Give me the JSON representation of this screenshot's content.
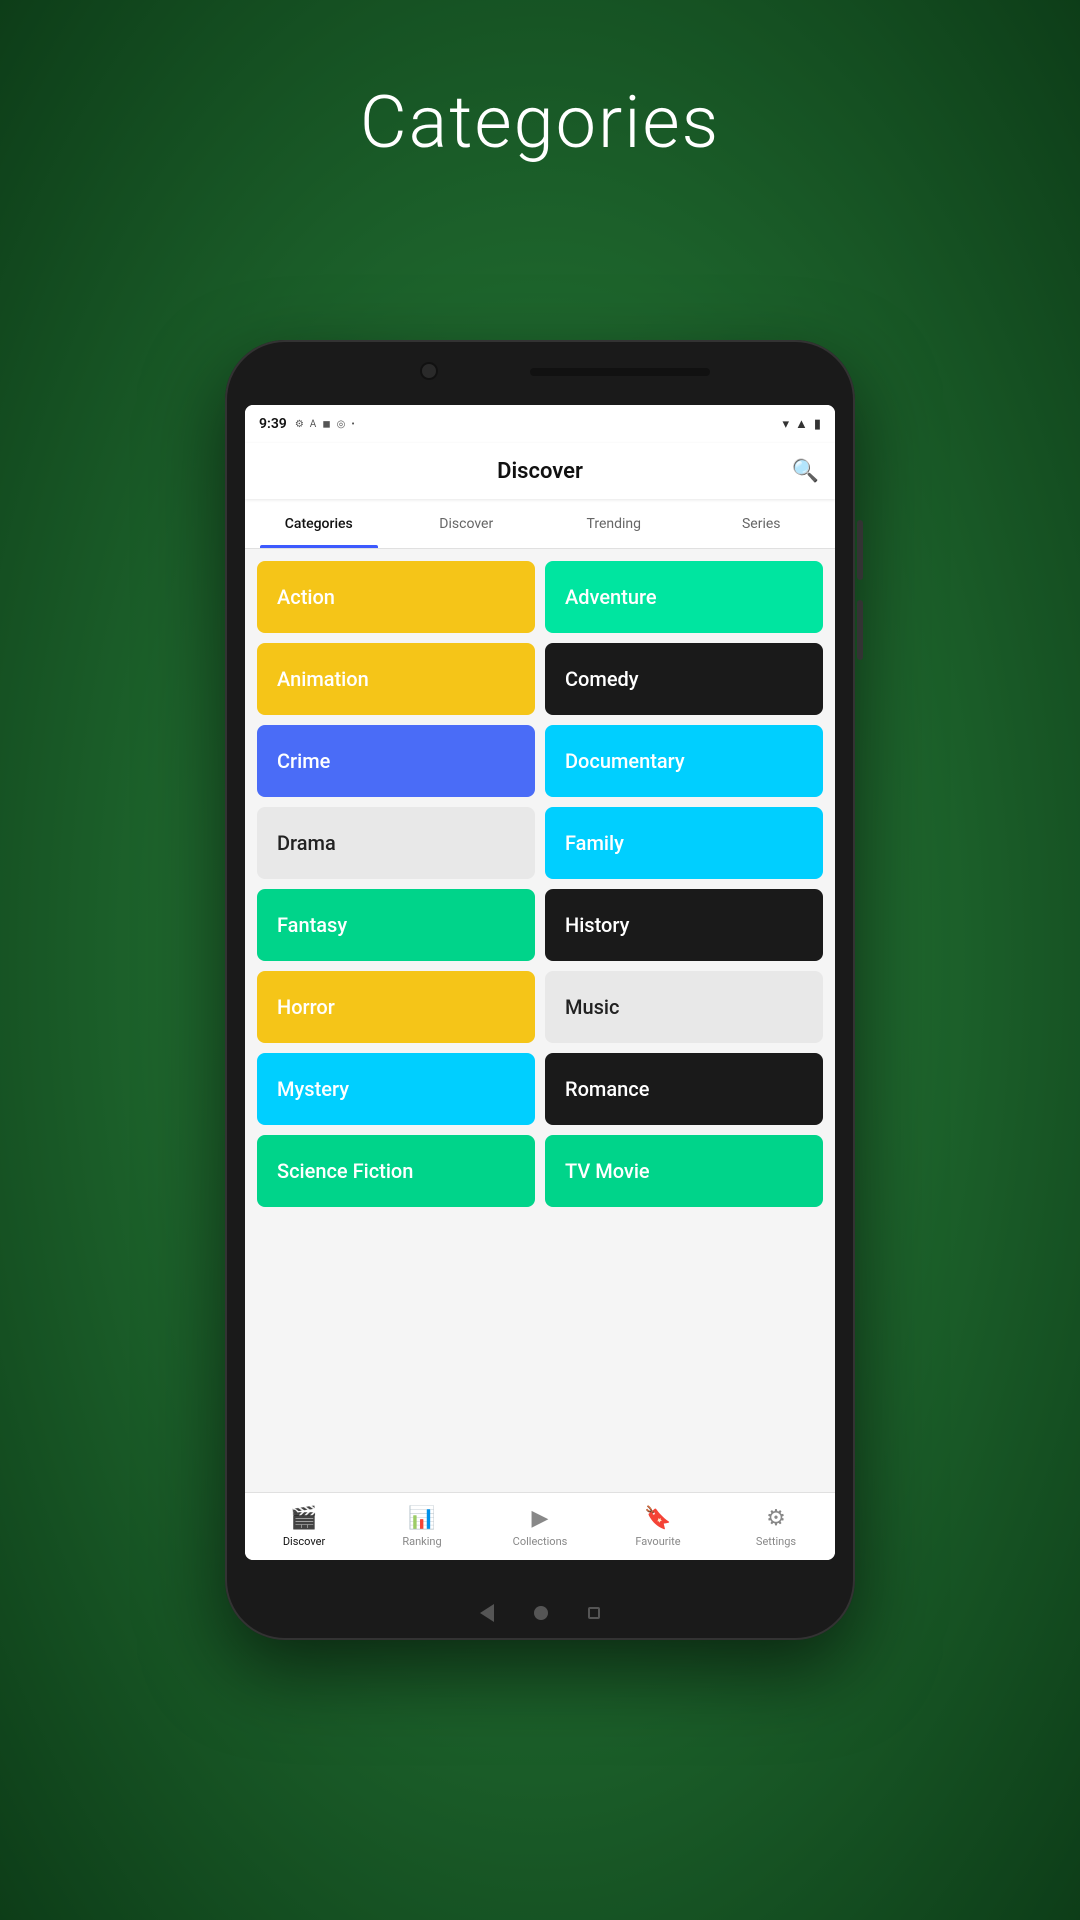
{
  "page": {
    "background_title": "Categories"
  },
  "status_bar": {
    "time": "9:39",
    "icons": [
      "⚙",
      "A",
      "🛡",
      "◎",
      "•"
    ],
    "wifi": "▼",
    "signal": "▲",
    "battery": "▬"
  },
  "app_bar": {
    "title": "Discover",
    "search_label": "search"
  },
  "tabs": [
    {
      "label": "Categories",
      "active": true
    },
    {
      "label": "Discover",
      "active": false
    },
    {
      "label": "Trending",
      "active": false
    },
    {
      "label": "Series",
      "active": false
    }
  ],
  "categories": [
    {
      "label": "Action",
      "bg": "#F5C518",
      "text_dark": false
    },
    {
      "label": "Adventure",
      "bg": "#00E5A0",
      "text_dark": false
    },
    {
      "label": "Animation",
      "bg": "#F5C518",
      "text_dark": false
    },
    {
      "label": "Comedy",
      "bg": "#1a1a1a",
      "text_dark": false
    },
    {
      "label": "Crime",
      "bg": "#4a6cf7",
      "text_dark": false
    },
    {
      "label": "Documentary",
      "bg": "#00CFFF",
      "text_dark": false
    },
    {
      "label": "Drama",
      "bg": "#e8e8e8",
      "text_dark": true
    },
    {
      "label": "Family",
      "bg": "#00CFFF",
      "text_dark": false
    },
    {
      "label": "Fantasy",
      "bg": "#00D48A",
      "text_dark": false
    },
    {
      "label": "History",
      "bg": "#1a1a1a",
      "text_dark": false
    },
    {
      "label": "Horror",
      "bg": "#F5C518",
      "text_dark": false
    },
    {
      "label": "Music",
      "bg": "#e8e8e8",
      "text_dark": true
    },
    {
      "label": "Mystery",
      "bg": "#00CFFF",
      "text_dark": false
    },
    {
      "label": "Romance",
      "bg": "#1a1a1a",
      "text_dark": false
    },
    {
      "label": "Science Fiction",
      "bg": "#00D48A",
      "text_dark": false
    },
    {
      "label": "TV Movie",
      "bg": "#00D48A",
      "text_dark": false
    }
  ],
  "bottom_nav": [
    {
      "label": "Discover",
      "icon": "🎬",
      "active": true
    },
    {
      "label": "Ranking",
      "icon": "📊",
      "active": false
    },
    {
      "label": "Collections",
      "icon": "▶",
      "active": false
    },
    {
      "label": "Favourite",
      "icon": "🔖",
      "active": false
    },
    {
      "label": "Settings",
      "icon": "⚙",
      "active": false
    }
  ]
}
